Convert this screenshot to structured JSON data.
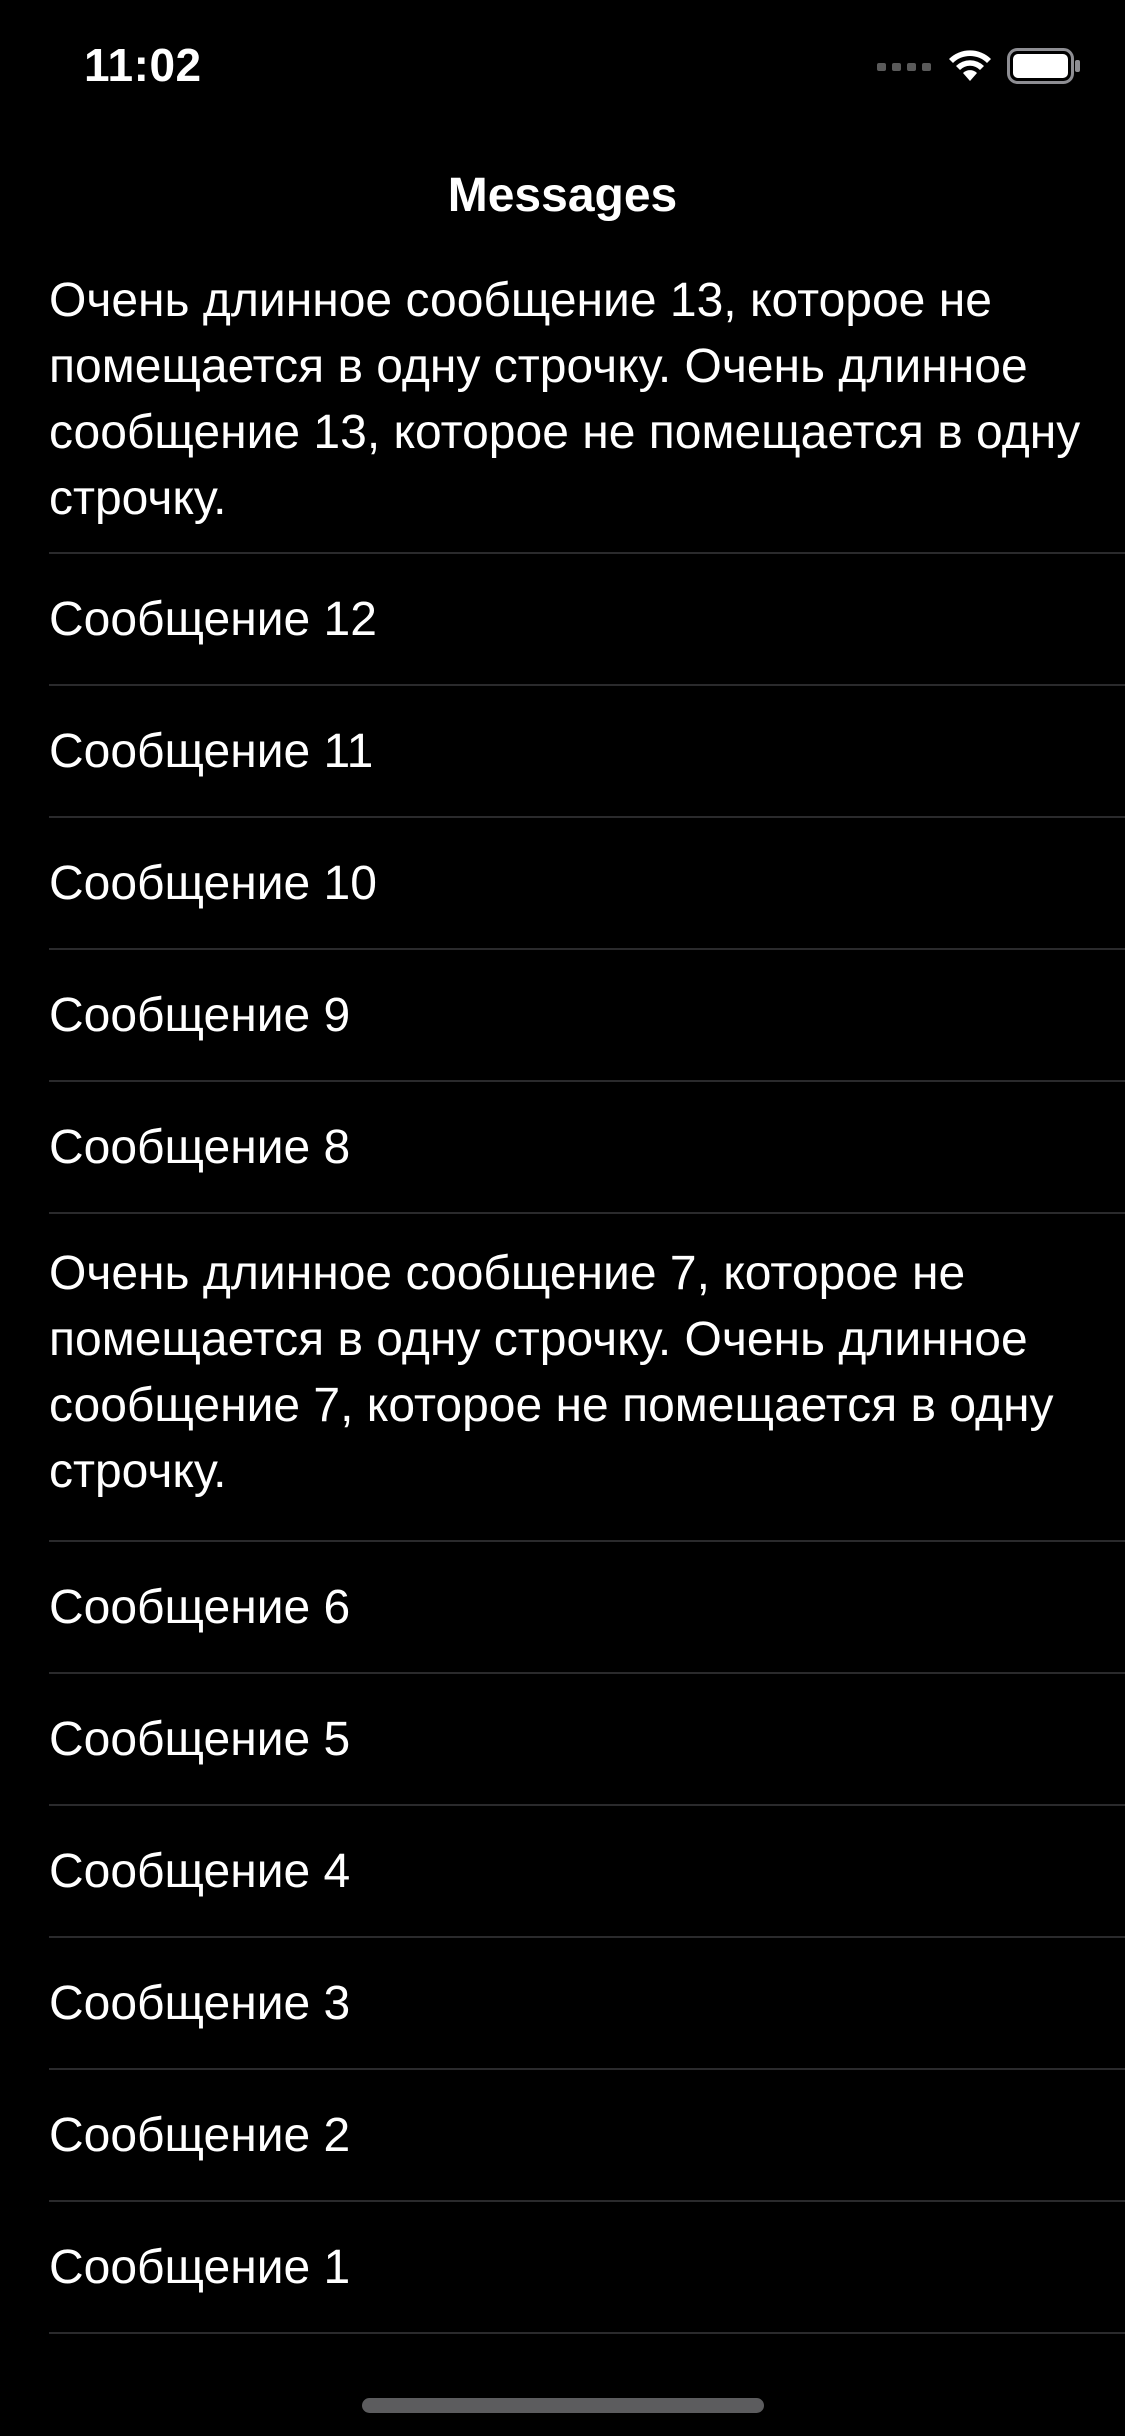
{
  "status_bar": {
    "time": "11:02",
    "signal_icon": "cellular-signal-icon",
    "wifi_icon": "wifi-icon",
    "battery_icon": "battery-icon"
  },
  "nav": {
    "title": "Messages"
  },
  "messages": [
    "Очень длинное сообщение 13, которое не помещается в одну строчку. Очень длинное сообщение 13, которое не помещается в одну строчку.",
    "Сообщение 12",
    "Сообщение 11",
    "Сообщение 10",
    "Сообщение 9",
    "Сообщение 8",
    "Очень длинное сообщение 7, которое не помещается в одну строчку. Очень длинное сообщение 7, которое не помещается в одну строчку.",
    "Сообщение 6",
    "Сообщение 5",
    "Сообщение 4",
    "Сообщение 3",
    "Сообщение 2",
    "Сообщение 1"
  ],
  "colors": {
    "background": "#000000",
    "text": "#ffffff",
    "separator": "#2a2a2c"
  }
}
